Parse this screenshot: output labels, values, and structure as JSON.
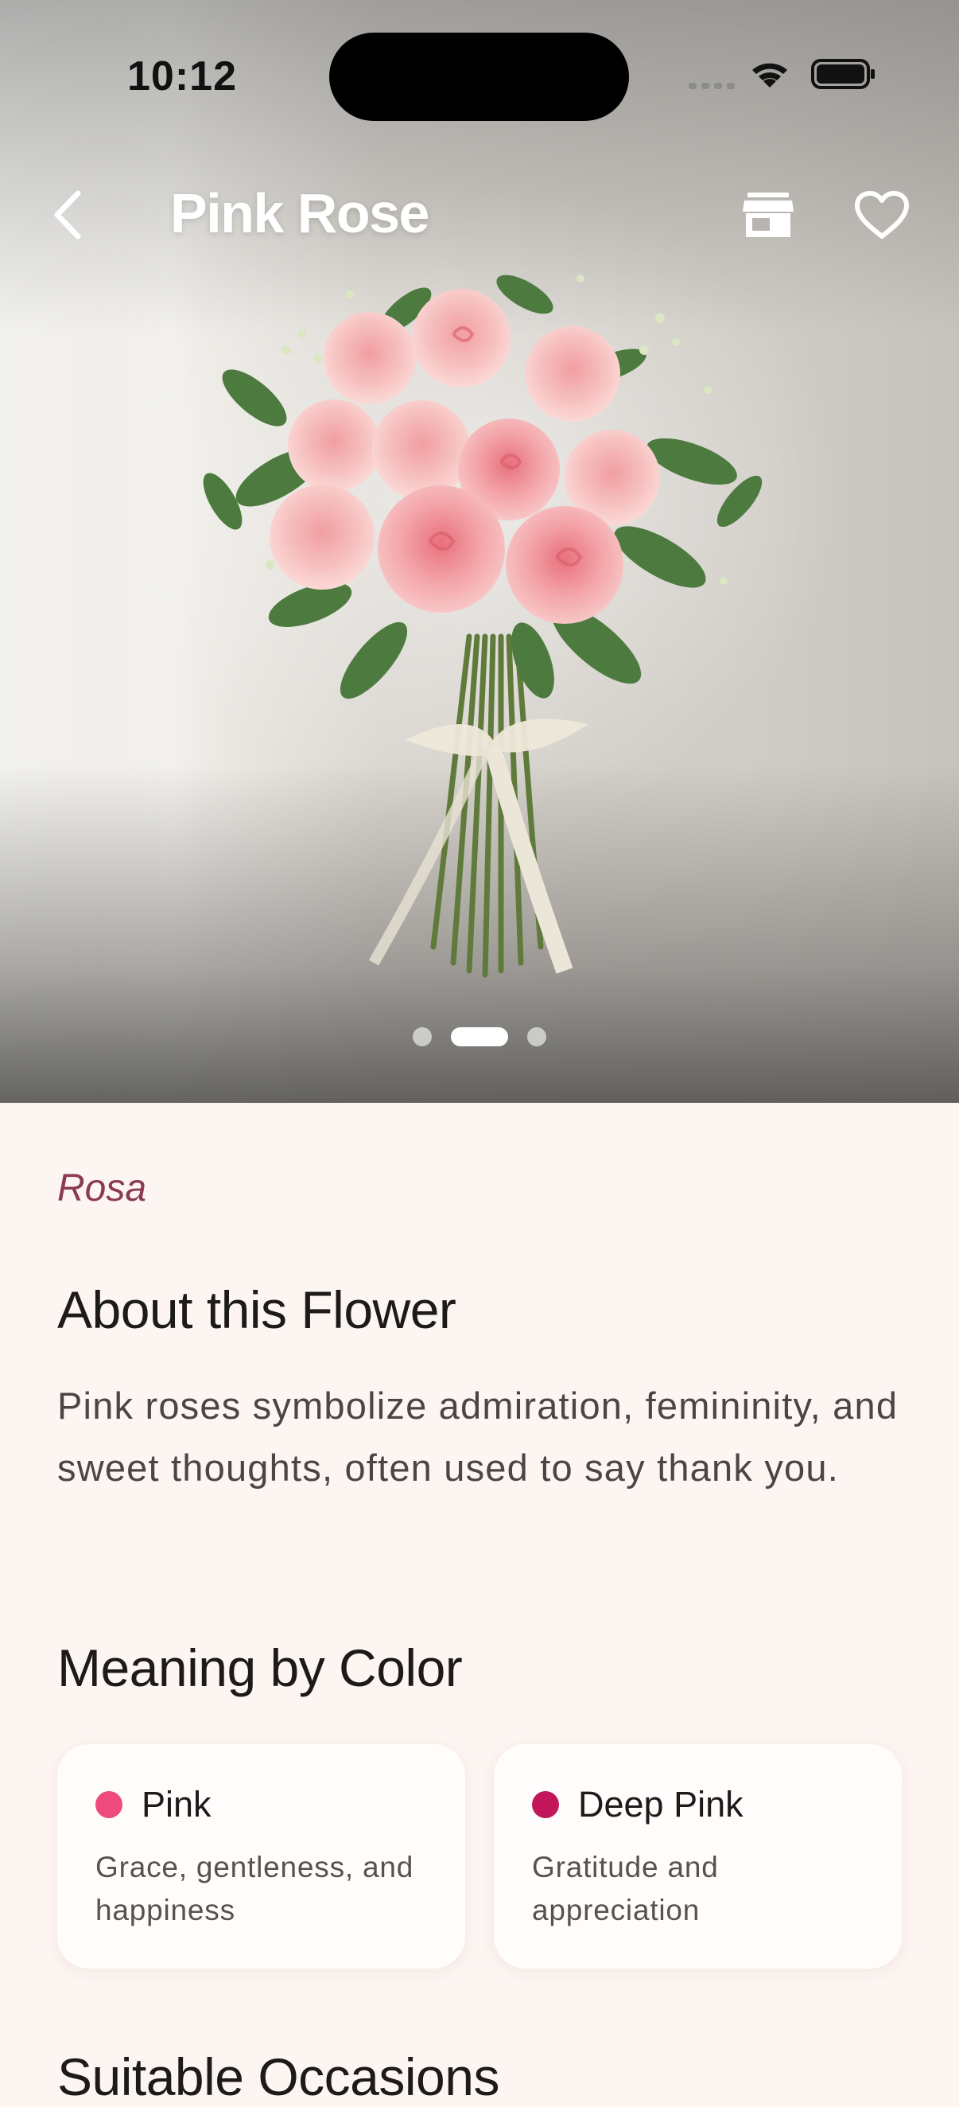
{
  "status_bar": {
    "time": "10:12"
  },
  "nav": {
    "title": "Pink Rose",
    "back_icon": "chevron-left-icon",
    "shop_icon": "storefront-icon",
    "favorite_icon": "heart-outline-icon"
  },
  "gallery": {
    "page_count": 3,
    "active_page": 2
  },
  "flower": {
    "scientific_name": "Rosa"
  },
  "about": {
    "title": "About this Flower",
    "body": "Pink roses symbolize admiration, femininity, and sweet thoughts, often used to say thank you."
  },
  "meaning": {
    "title": "Meaning by Color",
    "items": [
      {
        "name": "Pink",
        "color": "#ef4a7c",
        "description": "Grace, gentleness, and happiness"
      },
      {
        "name": "Deep Pink",
        "color": "#c2185b",
        "description": "Gratitude and appreciation"
      }
    ]
  },
  "occasions": {
    "title": "Suitable Occasions"
  },
  "colors": {
    "background": "#fdf5f2",
    "accent": "#8b3a56"
  }
}
